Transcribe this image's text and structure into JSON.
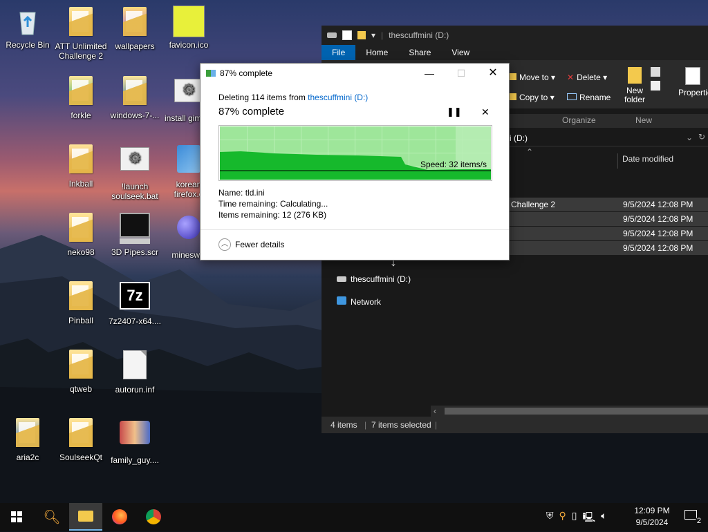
{
  "desktop": {
    "icons": [
      {
        "label": "Recycle Bin"
      },
      {
        "label": "ATT Unlimited Challenge 2"
      },
      {
        "label": "wallpapers"
      },
      {
        "label": "favicon.ico"
      },
      {
        "label": "forkle"
      },
      {
        "label": "windows-7-..."
      },
      {
        "label": "install gimp.b"
      },
      {
        "label": "Inkball"
      },
      {
        "label": "!launch soulseek.bat"
      },
      {
        "label": "korean firefox.e"
      },
      {
        "label": "neko98"
      },
      {
        "label": "3D Pipes.scr"
      },
      {
        "label": "minesww"
      },
      {
        "label": "Pinball"
      },
      {
        "label": "7z2407-x64...."
      },
      {
        "label": "qtweb"
      },
      {
        "label": "autorun.inf"
      },
      {
        "label": "aria2c"
      },
      {
        "label": "SoulseekQt"
      },
      {
        "label": "family_guy...."
      }
    ]
  },
  "explorer": {
    "title": "thescuffmini (D:)",
    "tabs": [
      "File",
      "Home",
      "Share",
      "View"
    ],
    "ribbon": {
      "move_to": "Move to",
      "copy_to": "Copy to",
      "delete": "Delete",
      "rename": "Rename",
      "new_folder": "New folder",
      "properties": "Properties",
      "organize": "Organize",
      "new": "New"
    },
    "address": "i (D:)",
    "column_date": "Date modified",
    "rows": [
      {
        "name": "Challenge 2",
        "date": "9/5/2024 12:08 PM"
      },
      {
        "name": "",
        "date": "9/5/2024 12:08 PM"
      },
      {
        "name": "",
        "date": "9/5/2024 12:08 PM"
      },
      {
        "name": "",
        "date": "9/5/2024 12:08 PM"
      }
    ],
    "nav": [
      {
        "label": "thescuffmini (D:)"
      },
      {
        "label": "Network"
      }
    ],
    "status_items": "4 items",
    "status_selected": "7 items selected"
  },
  "dialog": {
    "title": "87% complete",
    "deleting_prefix": "Deleting 114 items from ",
    "deleting_location": "thescuffmini (D:)",
    "percent": "87% complete",
    "speed": "Speed: 32 items/s",
    "name_label": "Name:",
    "name_value": "tld.ini",
    "time_label": "Time remaining:",
    "time_value": "Calculating...",
    "items_label": "Items remaining:",
    "items_value": "12 (276 KB)",
    "fewer_details": "Fewer details",
    "progress": 0.87,
    "accent": "#0066cc",
    "fill_color": "#16b92c"
  },
  "taskbar": {
    "time": "12:09 PM",
    "date": "9/5/2024",
    "notification_count": "2"
  }
}
